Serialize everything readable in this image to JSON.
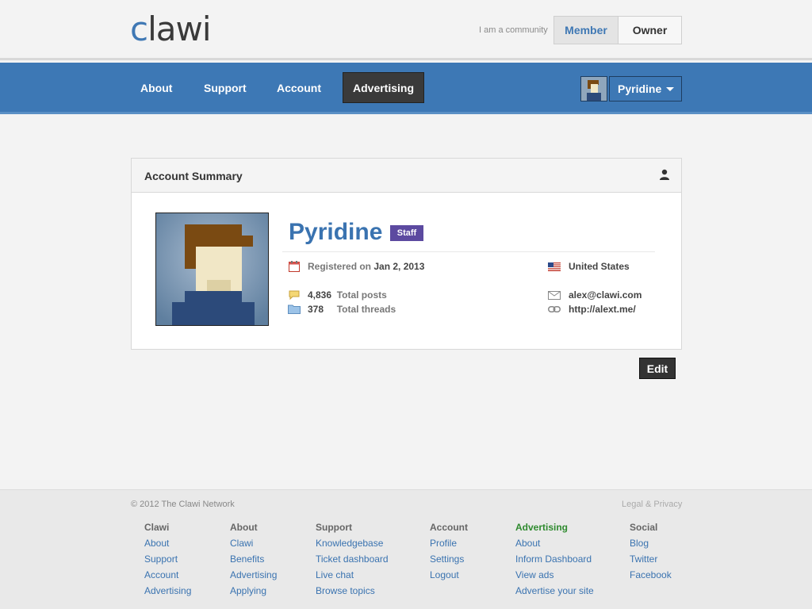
{
  "header": {
    "logo_c": "c",
    "logo_rest": "lawi",
    "community_label": "I am a community",
    "member_label": "Member",
    "owner_label": "Owner"
  },
  "nav": {
    "items": [
      {
        "label": "About"
      },
      {
        "label": "Support"
      },
      {
        "label": "Account"
      },
      {
        "label": "Advertising"
      }
    ],
    "active": "Advertising",
    "user": "Pyridine"
  },
  "card": {
    "title": "Account Summary",
    "username": "Pyridine",
    "badge": "Staff",
    "registered_label": "Registered on",
    "registered_date": "Jan 2, 2013",
    "country": "United States",
    "posts_count": "4,836",
    "posts_label": "Total posts",
    "threads_count": "378",
    "threads_label": "Total threads",
    "email": "alex@clawi.com",
    "website": "http://alext.me/"
  },
  "edit_label": "Edit",
  "footer": {
    "copyright": "© 2012 The Clawi Network",
    "legal": "Legal & Privacy",
    "columns": [
      {
        "heading": "Clawi",
        "links": [
          "About",
          "Support",
          "Account",
          "Advertising"
        ]
      },
      {
        "heading": "About",
        "links": [
          "Clawi",
          "Benefits",
          "Advertising",
          "Applying"
        ]
      },
      {
        "heading": "Support",
        "links": [
          "Knowledgebase",
          "Ticket dashboard",
          "Live chat",
          "Browse topics"
        ]
      },
      {
        "heading": "Account",
        "links": [
          "Profile",
          "Settings",
          "Logout"
        ]
      },
      {
        "heading": "Advertising",
        "links": [
          "About",
          "Inform Dashboard",
          "View ads",
          "Advertise your site"
        ]
      },
      {
        "heading": "Social",
        "links": [
          "Blog",
          "Twitter",
          "Facebook"
        ]
      }
    ]
  },
  "colors": {
    "brand_blue": "#3d78b5",
    "active_nav": "#3a3a3a",
    "staff_badge": "#5c4aa0",
    "link_blue": "#3a73b0",
    "advertising_heading": "#2e8a2e"
  }
}
